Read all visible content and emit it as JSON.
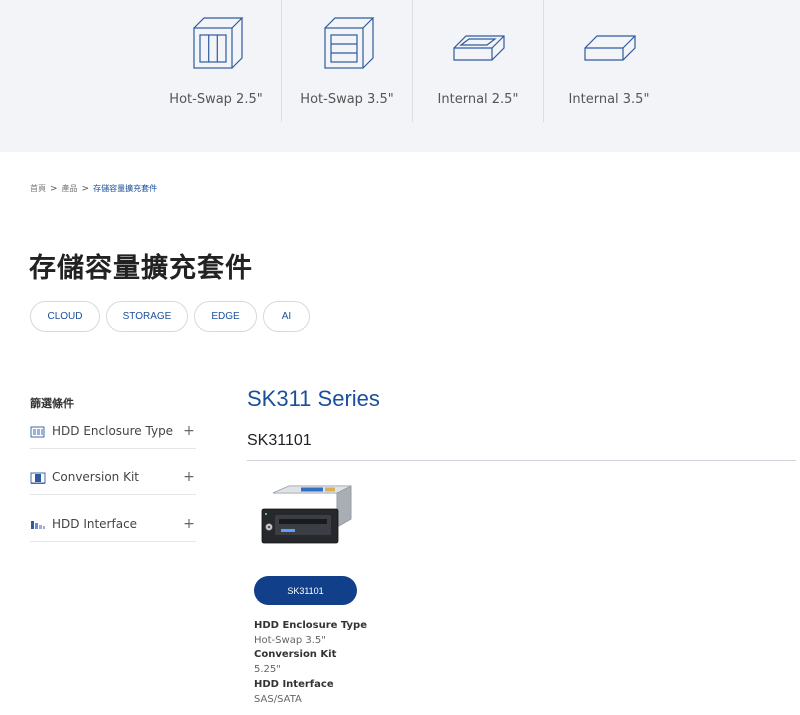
{
  "categories": [
    {
      "label": "Hot-Swap 2.5\"",
      "icon": "hot-swap-2-5-icon"
    },
    {
      "label": "Hot-Swap 3.5\"",
      "icon": "hot-swap-3-5-icon"
    },
    {
      "label": "Internal 2.5\"",
      "icon": "internal-2-5-icon"
    },
    {
      "label": "Internal 3.5\"",
      "icon": "internal-3-5-icon"
    }
  ],
  "breadcrumb": {
    "home": "首頁",
    "products": "產品",
    "current": "存儲容量擴充套件",
    "separator": ">"
  },
  "page_title": "存儲容量擴充套件",
  "pills": [
    "CLOUD",
    "STORAGE",
    "EDGE",
    "AI"
  ],
  "filter": {
    "title": "篩選條件",
    "items": [
      {
        "label": "HDD Enclosure Type",
        "icon": "hdd-enclosure-icon",
        "toggle": "+"
      },
      {
        "label": "Conversion Kit",
        "icon": "conversion-kit-icon",
        "toggle": "+"
      },
      {
        "label": "HDD Interface",
        "icon": "hdd-interface-icon",
        "toggle": "+"
      }
    ]
  },
  "series": {
    "title": "SK311 Series",
    "model": "SK31101",
    "product_button": "SK31101",
    "specs": [
      {
        "label": "HDD Enclosure Type",
        "value": "Hot-Swap 3.5\""
      },
      {
        "label": "Conversion Kit",
        "value": "5.25\""
      },
      {
        "label": "HDD Interface",
        "value": "SAS/SATA"
      }
    ]
  },
  "colors": {
    "accent": "#1a4f9c",
    "button": "#123f8a",
    "band": "#f3f4f7",
    "icon_stroke": "#2f5a9e"
  }
}
